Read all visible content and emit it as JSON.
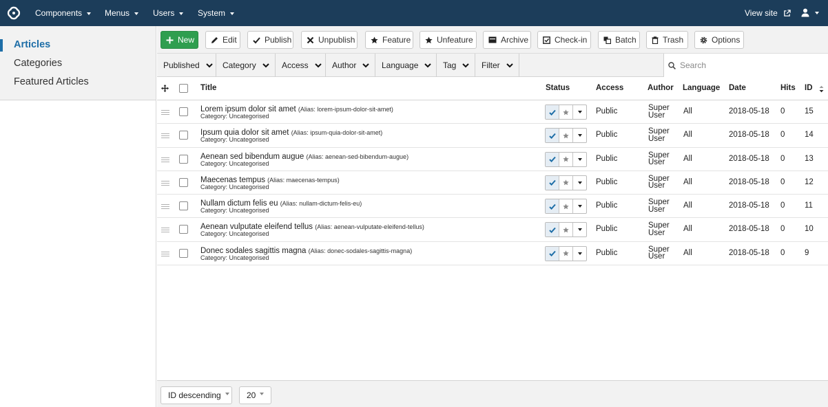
{
  "topnav": {
    "menus": [
      {
        "label": "Components"
      },
      {
        "label": "Menus"
      },
      {
        "label": "Users"
      },
      {
        "label": "System"
      }
    ],
    "view_site": "View site",
    "bg_color": "#1c3d5a"
  },
  "sidebar": {
    "items": [
      {
        "label": "Articles",
        "active": true
      },
      {
        "label": "Categories",
        "active": false
      },
      {
        "label": "Featured Articles",
        "active": false
      }
    ]
  },
  "toolbar": {
    "buttons": [
      {
        "label": "New",
        "icon": "plus-icon"
      },
      {
        "label": "Edit",
        "icon": "pencil-icon"
      },
      {
        "label": "Publish",
        "icon": "check-icon"
      },
      {
        "label": "Unpublish",
        "icon": "x-icon"
      },
      {
        "label": "Feature",
        "icon": "star-icon"
      },
      {
        "label": "Unfeature",
        "icon": "star-icon"
      },
      {
        "label": "Archive",
        "icon": "archive-icon"
      },
      {
        "label": "Check-in",
        "icon": "checkin-icon"
      },
      {
        "label": "Batch",
        "icon": "batch-icon"
      },
      {
        "label": "Trash",
        "icon": "trash-icon"
      },
      {
        "label": "Options",
        "icon": "gear-icon"
      }
    ],
    "new_color": "#2f9e4f"
  },
  "filters": {
    "items": [
      {
        "label": "Published"
      },
      {
        "label": "Category"
      },
      {
        "label": "Access"
      },
      {
        "label": "Author"
      },
      {
        "label": "Language"
      },
      {
        "label": "Tag"
      },
      {
        "label": "Filter"
      }
    ],
    "search_placeholder": "Search"
  },
  "table": {
    "headers": {
      "title": "Title",
      "status": "Status",
      "access": "Access",
      "author": "Author",
      "language": "Language",
      "date": "Date",
      "hits": "Hits",
      "id": "ID"
    },
    "rows": [
      {
        "title": "Lorem ipsum dolor sit amet",
        "alias": "(Alias: lorem-ipsum-dolor-sit-amet)",
        "category": "Category: Uncategorised",
        "access": "Public",
        "author1": "Super",
        "author2": "User",
        "language": "All",
        "date": "2018-05-18",
        "hits": "0",
        "id": "15"
      },
      {
        "title": "Ipsum quia dolor sit amet",
        "alias": "(Alias: ipsum-quia-dolor-sit-amet)",
        "category": "Category: Uncategorised",
        "access": "Public",
        "author1": "Super",
        "author2": "User",
        "language": "All",
        "date": "2018-05-18",
        "hits": "0",
        "id": "14"
      },
      {
        "title": "Aenean sed bibendum augue",
        "alias": "(Alias: aenean-sed-bibendum-augue)",
        "category": "Category: Uncategorised",
        "access": "Public",
        "author1": "Super",
        "author2": "User",
        "language": "All",
        "date": "2018-05-18",
        "hits": "0",
        "id": "13"
      },
      {
        "title": "Maecenas tempus",
        "alias": "(Alias: maecenas-tempus)",
        "category": "Category: Uncategorised",
        "access": "Public",
        "author1": "Super",
        "author2": "User",
        "language": "All",
        "date": "2018-05-18",
        "hits": "0",
        "id": "12"
      },
      {
        "title": "Nullam dictum felis eu",
        "alias": "(Alias: nullam-dictum-felis-eu)",
        "category": "Category: Uncategorised",
        "access": "Public",
        "author1": "Super",
        "author2": "User",
        "language": "All",
        "date": "2018-05-18",
        "hits": "0",
        "id": "11"
      },
      {
        "title": "Aenean vulputate eleifend tellus",
        "alias": "(Alias: aenean-vulputate-eleifend-tellus)",
        "category": "Category: Uncategorised",
        "access": "Public",
        "author1": "Super",
        "author2": "User",
        "language": "All",
        "date": "2018-05-18",
        "hits": "0",
        "id": "10"
      },
      {
        "title": "Donec sodales sagittis magna",
        "alias": "(Alias: donec-sodales-sagittis-magna)",
        "category": "Category: Uncategorised",
        "access": "Public",
        "author1": "Super",
        "author2": "User",
        "language": "All",
        "date": "2018-05-18",
        "hits": "0",
        "id": "9"
      }
    ]
  },
  "footer": {
    "ordering": "ID descending",
    "limit": "20"
  },
  "colors": {
    "accent": "#1e6ea7",
    "published_check": "#1e6ea7"
  }
}
